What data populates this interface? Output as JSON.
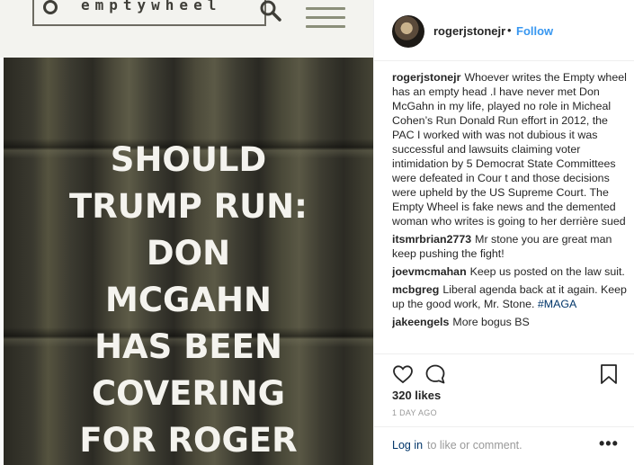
{
  "site": {
    "logo_text": "emptywheel",
    "search_icon": "search-icon",
    "menu_icon": "hamburger-menu-icon"
  },
  "photo": {
    "headline_lines": [
      "SHOULD",
      "TRUMP RUN:",
      "DON",
      "MCGAHN",
      "HAS BEEN",
      "COVERING",
      "FOR ROGER"
    ]
  },
  "post": {
    "username": "rogerjstonejr",
    "separator": "•",
    "follow_label": "Follow",
    "caption": {
      "user": "rogerjstonejr",
      "text": "Whoever writes the Empty wheel has an empty head .I have never met Don McGahn in my life, played no role in Micheal Cohen’s Run Donald Run effort in 2012, the PAC I worked with was not dubious it was successful and lawsuits claiming voter intimidation by 5 Democrat State Committees were defeated in Cour t and those decisions were upheld by the US Supreme Court. The Empty Wheel is fake news and the demented woman who writes is going to her derrière sued"
    },
    "comments": [
      {
        "user": "itsmrbrian2773",
        "text": "Mr stone you are great man keep pushing the fight!"
      },
      {
        "user": "joevmcmahan",
        "text": "Keep us posted on the law suit."
      },
      {
        "user": "mcbgreg",
        "text": "Liberal agenda back at it again. Keep up the good work, Mr. Stone.",
        "hashtag": "#MAGA"
      },
      {
        "user": "jakeengels",
        "text": "More bogus BS"
      }
    ],
    "likes": "320 likes",
    "date": "1 DAY AGO",
    "login_link": "Log in",
    "login_rest": "to like or comment.",
    "more_label": "•••",
    "icons": {
      "like": "heart-icon",
      "comment": "comment-icon",
      "save": "bookmark-icon"
    }
  },
  "colors": {
    "link_blue": "#3897f0",
    "dark_link": "#003569",
    "muted": "#999999"
  }
}
